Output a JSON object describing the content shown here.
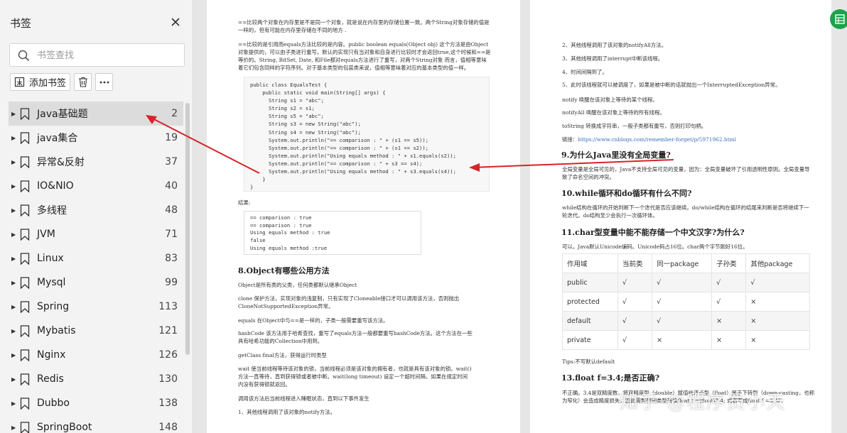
{
  "sidebar": {
    "title": "书签",
    "search_placeholder": "书签查找",
    "add_label": "添加书签",
    "items": [
      {
        "name": "Java基础题",
        "page": "2"
      },
      {
        "name": "java集合",
        "page": "19"
      },
      {
        "name": "异常&反射",
        "page": "37"
      },
      {
        "name": "IO&NIO",
        "page": "40"
      },
      {
        "name": "多线程",
        "page": "48"
      },
      {
        "name": "JVM",
        "page": "71"
      },
      {
        "name": "Linux",
        "page": "83"
      },
      {
        "name": "Mysql",
        "page": "99"
      },
      {
        "name": "Spring",
        "page": "113"
      },
      {
        "name": "Mybatis",
        "page": "121"
      },
      {
        "name": "Nginx",
        "page": "126"
      },
      {
        "name": "Redis",
        "page": "130"
      },
      {
        "name": "Dubbo",
        "page": "138"
      },
      {
        "name": "SpringBoot",
        "page": "148"
      }
    ]
  },
  "page1": {
    "para1": "==比较两个对象在内存里是不是同一个对象，就是说在内存里的存储位置一致。两个String对象存储的值是一样的，但有可能在内存里存储在不同的地方 .",
    "para2": "==比较的是引用而equals方法比较的是内容。public boolean equals(Object obj) 这个方法是由Object对象提供的，可以由子类进行重写。默认的实现只有当对象和自身进行比较时才会返回true,这个时候和==是等价的。String, BitSet, Date, 和File都对equals方法进行了重写，对两个String对象 而言，值相等意味着它们包含同样的字符序列。对于基本类型的包装类来说，值相等意味着对应的基本类型的值一样。",
    "code": [
      "public class EqualsTest {",
      "    public static void main(String[] args) {",
      "      String s1 = \"abc\";",
      "      String s2 = s1;",
      "      String s5 = \"abc\";",
      "      String s3 = new String(\"abc\");",
      "      String s4 = new String(\"abc\");",
      "      System.out.println(\"== comparison : \" + (s1 == s5));",
      "      System.out.println(\"== comparison : \" + (s1 == s2));",
      "      System.out.println(\"Using equals method : \" + s1.equals(s2));",
      "      System.out.println(\"== comparison : \" + s3 == s4);",
      "      System.out.println(\"Using equals method : \" + s3.equals(s4));",
      "    }",
      "}"
    ],
    "result_label": "结果:",
    "result": "== comparison : true\n== comparison : true\nUsing equals method : true\nfalse\nUsing equals method :true",
    "h8": "8.Object有哪些公用方法",
    "obj_desc": "Object是所有类的父类，任何类都默认继承Object",
    "clone": "clone 保护方法，实现对象的浅复制，只有实现了Cloneable接口才可以调用该方法，否则抛出CloneNotSupportedException异常。",
    "equals": "equals 在Object中与==是一样的，子类一般需要重写该方法。",
    "hashcode": "hashCode 该方法用于哈希查找，重写了equals方法一般都要重写hashCode方法。这个方法在一些具有哈希功能的Collection中用到。",
    "getclass": "getClass final方法，获得运行时类型",
    "wait": "wait 使当前线程等待该对象的锁，当前线程必须是该对象的拥有者，也就是具有该对象的锁。wait() 方法一直等待，直到获得锁或者被中断。wait(long timeout) 设定一个超时间隔，如果在规定时间内没有获得锁就返回。",
    "wakeup": "调用该方法后当前线程进入睡眠状态，直到以下事件发生",
    "item1": "1、其他线程调用了该对象的notify方法。"
  },
  "page2": {
    "l2": "2、其他线程调用了该对象的notifyAll方法。",
    "l3": "3、其他线程调用了interrupt中断该线程。",
    "l4": "4、时间间隔到了。",
    "l5": "5、此时该线程就可以被调度了，如果是被中断的话就抛出一个InterruptedException异常。",
    "notify": "notify 唤醒在该对象上等待的某个线程。",
    "notifyall": "notifyAll 唤醒在该对象上等待的所有线程。",
    "tostring": "toString 转换成字符串，一般子类都有重写，否则打印句柄。",
    "link_label": "链接：",
    "link": "https://www.cnblogs.com/remember-forget/p/5971962.html",
    "h9": "9.为什么Java里没有全局变量?",
    "p9": "全局变量是全局可见的，Java不支持全局可见的变量，因为：全局变量破坏了引用透明性原则。全局变量导致了命名空间的冲突。",
    "h10": "10.while循环和do循环有什么不同?",
    "p10": "while结构在循环的开始判断下一个迭代是否应该继续。do/while结构在循环的结尾来判断是否将继续下一轮迭代。do结构至少会执行一次循环体。",
    "h11": "11.char型变量中能不能存储一个中文汉字?为什么?",
    "p11": "可以。Java默认Unicode编码。Unicode码占16位。char两个字节刚好16位。",
    "table": [
      [
        "作用域",
        "当前类",
        "同一package",
        "子孙类",
        "其他package"
      ],
      [
        "public",
        "√",
        "√",
        "√",
        "√"
      ],
      [
        "protected",
        "√",
        "√",
        "√",
        "×"
      ],
      [
        "default",
        "√",
        "√",
        "×",
        "×"
      ],
      [
        "private",
        "√",
        "×",
        "×",
        "×"
      ]
    ],
    "tips": "Tips:不写默认default",
    "h13": "13.float f=3.4;是否正确?",
    "p13": "不正确。3.4是双精度数，将双精度型（double）赋值给浮点型（float）属于下转型（down-casting，也称为窄化）会造成精度损失，因此需要强制类型转换float f =(float)3.4; 或者写成float f =3.4F;"
  },
  "watermark": "知乎 @程序员小天"
}
